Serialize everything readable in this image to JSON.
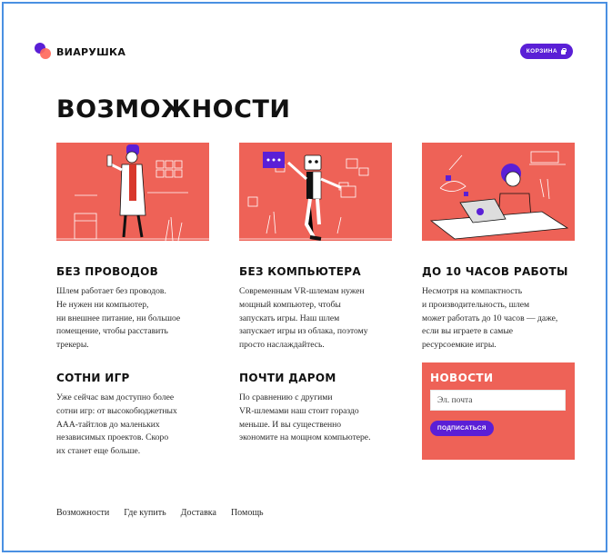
{
  "brand": {
    "name": "ВИАРУШКА",
    "primary": "#5a1fd6",
    "accent": "#ee6257"
  },
  "header": {
    "cart_label": "КОРЗИНА",
    "cart_icon": "bag-icon"
  },
  "page": {
    "title": "ВОЗМОЖНОСТИ"
  },
  "features": [
    {
      "title": "БЕЗ ПРОВОДОВ",
      "text": "Шлем работает без проводов.\nНе нужен ни компьютер,\nни внешнее питание, ни большое\nпомещение, чтобы расставить\nтрекеры."
    },
    {
      "title": "БЕЗ КОМПЬЮТЕРА",
      "text": "Современным VR-шлемам нужен\nмощный компьютер, чтобы\nзапускать игры. Наш шлем\nзапускает игры из облака, поэтому\nпросто наслаждайтесь."
    },
    {
      "title": "ДО 10 ЧАСОВ РАБОТЫ",
      "text": "Несмотря на компактность\nи производительность, шлем\nможет работать до 10 часов — даже,\nесли вы играете в самые\nресурсоемкие игры."
    },
    {
      "title": "СОТНИ ИГР",
      "text": "Уже сейчас вам доступно более\nсотни игр: от высокобюджетных\nAAA-тайтлов до маленьких\nнезависимых проектов. Скоро\nих станет еще больше."
    },
    {
      "title": "ПОЧТИ ДАРОМ",
      "text": "По сравнению с другими\nVR-шлемами наш стоит гораздо\nменьше. И вы существенно\nэкономите на мощном компьютере."
    }
  ],
  "newsletter": {
    "title": "НОВОСТИ",
    "placeholder": "Эл. почта",
    "button_label": "ПОДПИСАТЬСЯ"
  },
  "footer": {
    "links": [
      "Возможности",
      "Где купить",
      "Доставка",
      "Помощь"
    ]
  }
}
